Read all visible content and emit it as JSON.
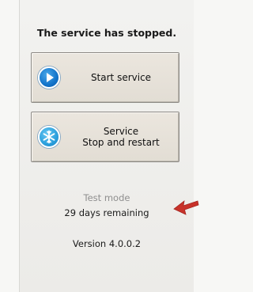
{
  "status": {
    "text": "The service has stopped."
  },
  "buttons": {
    "start": {
      "label": "Start service",
      "icon": "play-icon"
    },
    "service": {
      "line1": "Service",
      "line2": "Stop and restart",
      "icon": "snowflake-icon"
    }
  },
  "license": {
    "mode": "Test mode",
    "remaining": "29 days remaining"
  },
  "version": {
    "text": "Version 4.0.0.2"
  },
  "colors": {
    "accent_blue": "#1273c9",
    "arrow_red": "#c8322a",
    "button_face": "#e6e1d8"
  }
}
